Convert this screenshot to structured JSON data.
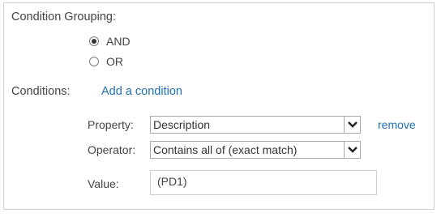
{
  "condition_grouping": {
    "label": "Condition Grouping:",
    "options": [
      {
        "label": "AND",
        "selected": true
      },
      {
        "label": "OR",
        "selected": false
      }
    ]
  },
  "conditions": {
    "label": "Conditions:",
    "add_link": "Add a condition",
    "items": [
      {
        "property_label": "Property:",
        "property_value": "Description",
        "remove_label": "remove",
        "operator_label": "Operator:",
        "operator_value": "Contains all of (exact match)",
        "value_label": "Value:",
        "value": "(PD1)"
      }
    ]
  },
  "icons": {
    "dropdown": "chevron-down-icon"
  },
  "colors": {
    "link": "#1f6fb2",
    "text": "#444444",
    "border": "#a9a9a9"
  }
}
